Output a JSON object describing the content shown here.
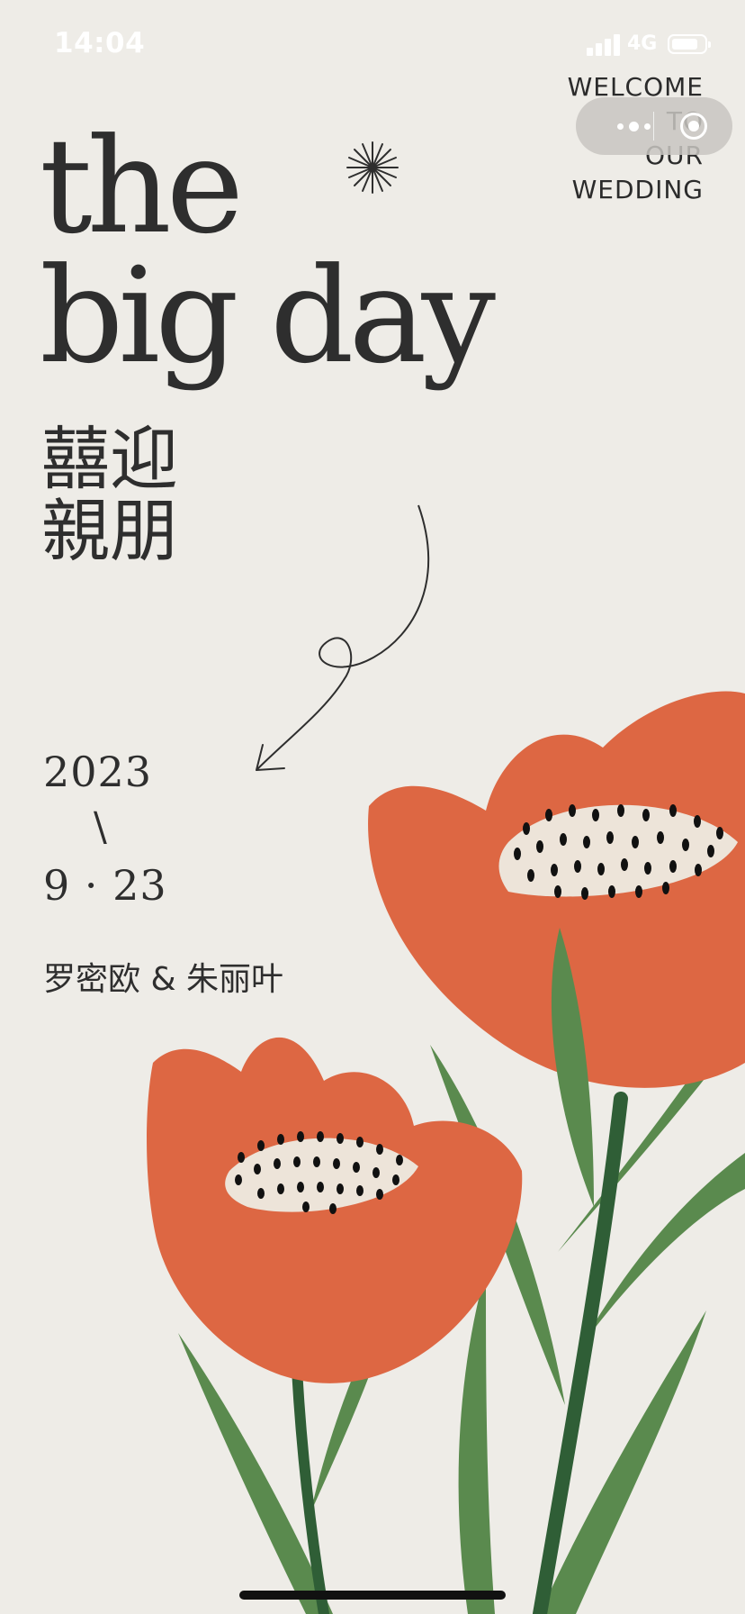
{
  "status_bar": {
    "time": "14:04",
    "network": "4G"
  },
  "welcome": {
    "line1": "WELCOME",
    "line2": "TO",
    "line3": "OUR",
    "line4": "WEDDING"
  },
  "title": {
    "line1": "the",
    "line2": "big day"
  },
  "chinese_title": {
    "line1": "囍迎",
    "line2": "親朋"
  },
  "date": {
    "year": "2023",
    "separator": "\\",
    "month_day": "9 · 23"
  },
  "couple": "罗密欧 & 朱丽叶",
  "colors": {
    "background": "#EEECE7",
    "petal": "#DD6743",
    "leaf": "#5A8A4E",
    "stem": "#2F5E36",
    "center": "#EDE4D9"
  },
  "icons": [
    "signal-icon",
    "battery-icon",
    "more-dots-icon",
    "close-target-icon",
    "sparkle-icon",
    "arrow-doodle-icon"
  ]
}
